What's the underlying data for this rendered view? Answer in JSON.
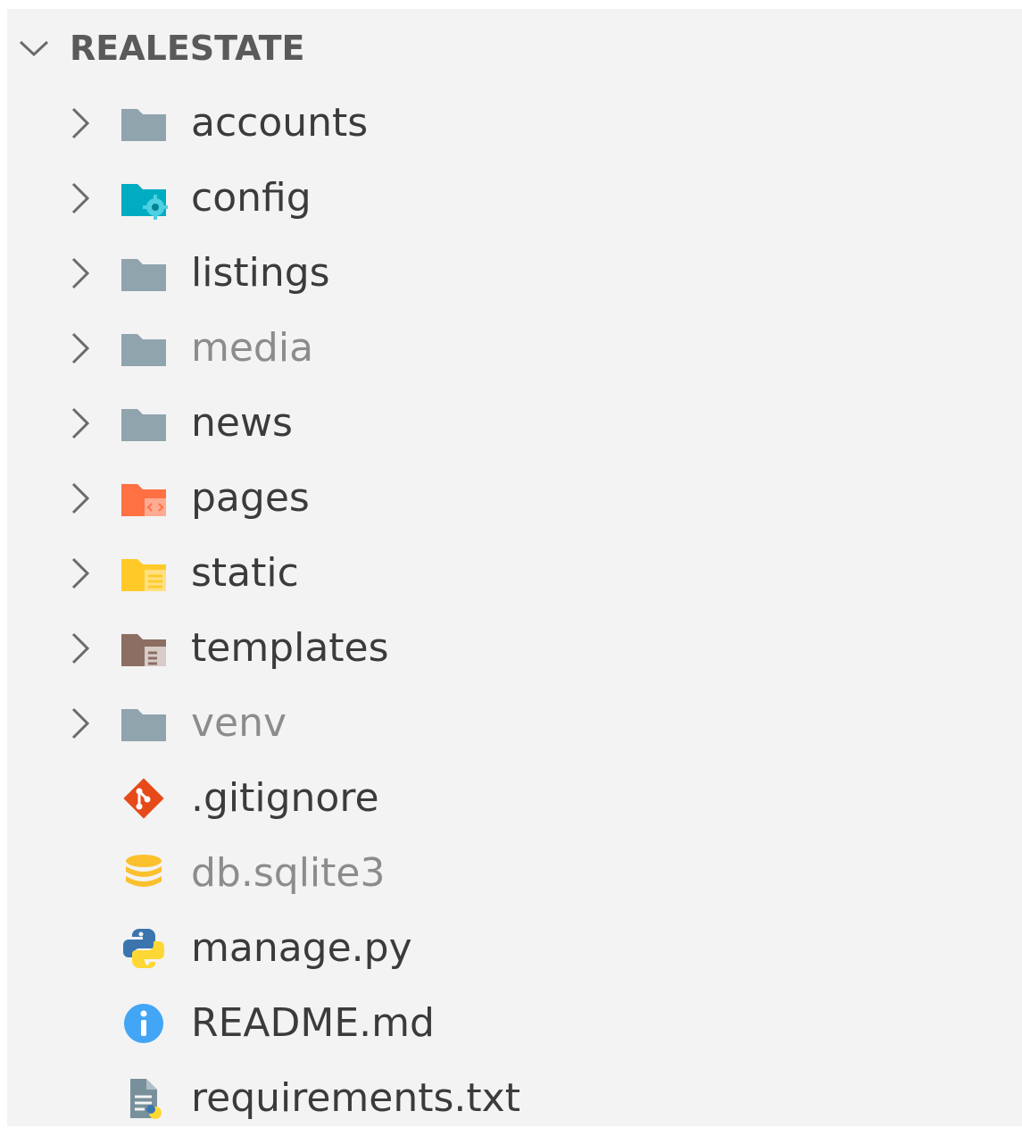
{
  "explorer": {
    "root_label": "REALESTATE",
    "items": [
      {
        "label": "accounts",
        "icon": "folder-icon",
        "kind": "folder",
        "dimmed": false
      },
      {
        "label": "config",
        "icon": "folder-config-icon",
        "kind": "folder",
        "dimmed": false
      },
      {
        "label": "listings",
        "icon": "folder-icon",
        "kind": "folder",
        "dimmed": false
      },
      {
        "label": "media",
        "icon": "folder-icon",
        "kind": "folder",
        "dimmed": true
      },
      {
        "label": "news",
        "icon": "folder-icon",
        "kind": "folder",
        "dimmed": false
      },
      {
        "label": "pages",
        "icon": "folder-pages-icon",
        "kind": "folder",
        "dimmed": false
      },
      {
        "label": "static",
        "icon": "folder-static-icon",
        "kind": "folder",
        "dimmed": false
      },
      {
        "label": "templates",
        "icon": "folder-templates-icon",
        "kind": "folder",
        "dimmed": false
      },
      {
        "label": "venv",
        "icon": "folder-icon",
        "kind": "folder",
        "dimmed": true
      },
      {
        "label": ".gitignore",
        "icon": "git-icon",
        "kind": "file",
        "dimmed": false
      },
      {
        "label": "db.sqlite3",
        "icon": "database-icon",
        "kind": "file",
        "dimmed": true
      },
      {
        "label": "manage.py",
        "icon": "python-icon",
        "kind": "file",
        "dimmed": false
      },
      {
        "label": "README.md",
        "icon": "info-icon",
        "kind": "file",
        "dimmed": false
      },
      {
        "label": "requirements.txt",
        "icon": "requirements-file-icon",
        "kind": "file",
        "dimmed": false
      }
    ]
  },
  "colors": {
    "background": "#f3f3f3",
    "text": "#3b3b3b",
    "dim_text": "#8c8c8c",
    "folder_gray": "#90a4ae",
    "config_teal": "#00acc1",
    "pages_orange": "#ff7043",
    "static_yellow": "#ffca28",
    "templates_brown": "#8d6e63",
    "git_red": "#e64a19",
    "db_yellow": "#fbc02d",
    "python_blue": "#3a75b0",
    "python_yellow": "#fdd835",
    "info_blue": "#42a5f5",
    "file_gray": "#78909c"
  }
}
